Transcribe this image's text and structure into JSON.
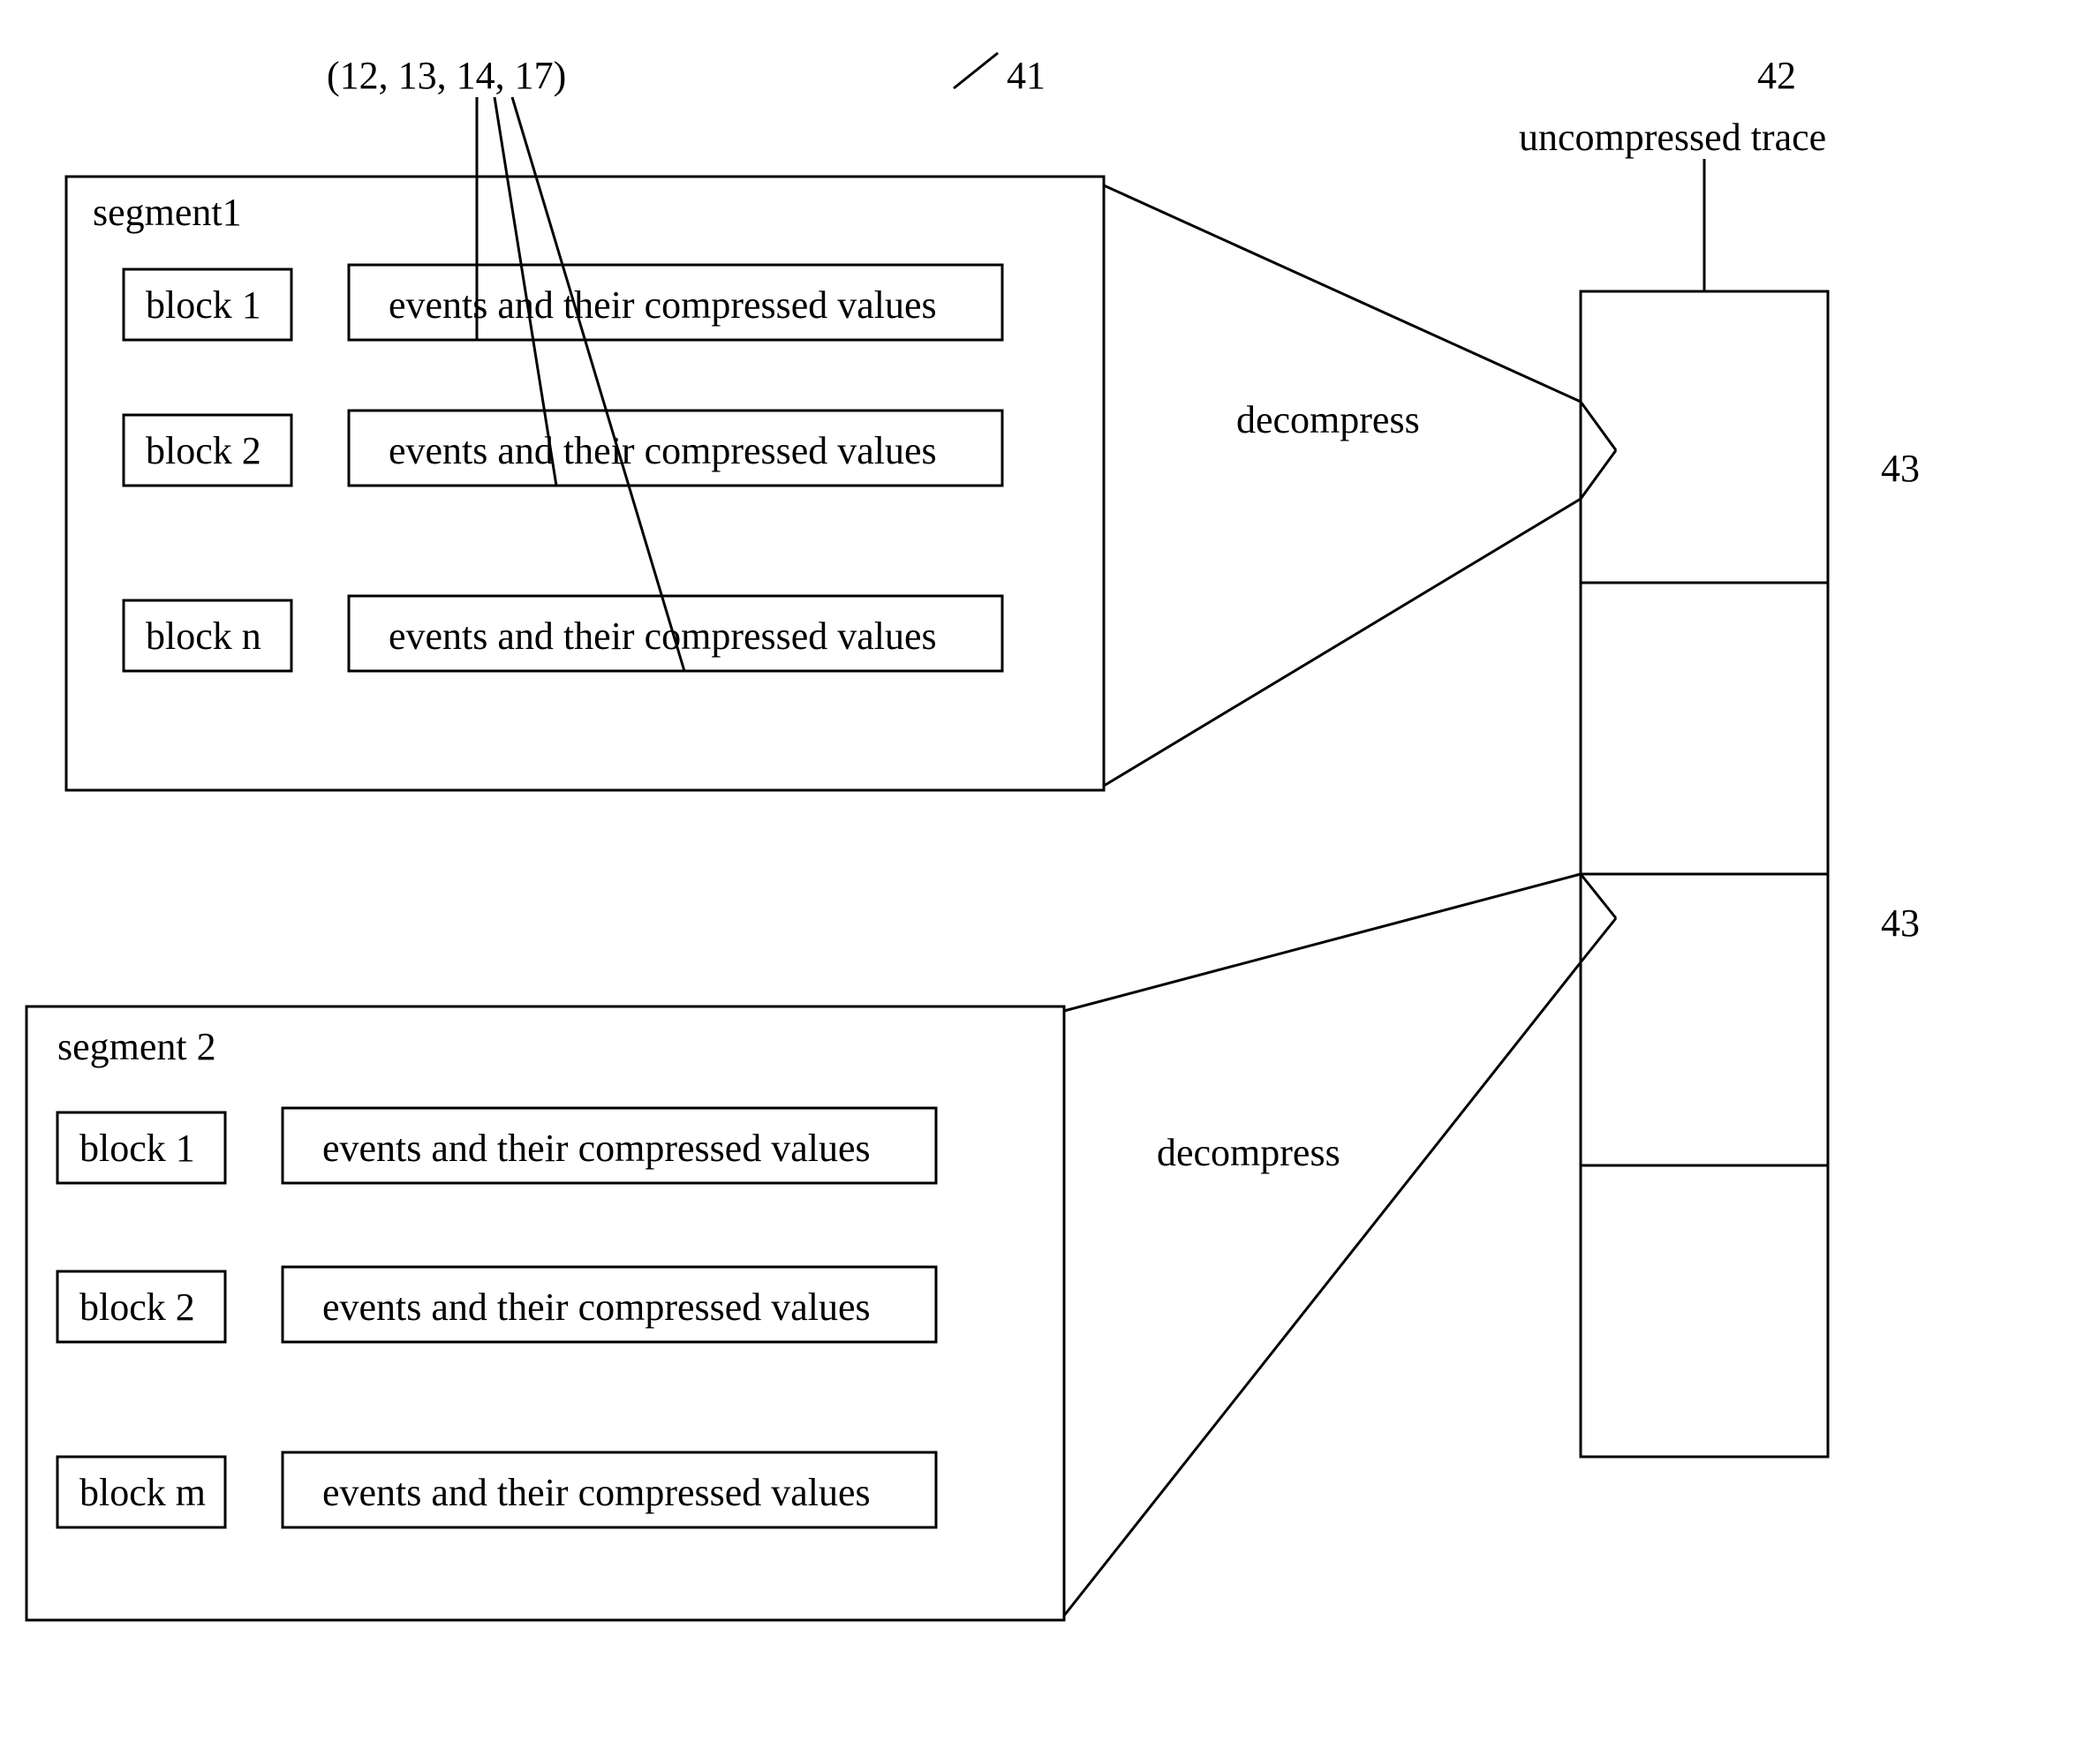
{
  "header": {
    "tuple": "(12, 13, 14, 17)"
  },
  "callouts": {
    "segment1_ref": "41",
    "trace_ref": "42",
    "trace_row_ref_1": "43",
    "trace_row_ref_2": "43"
  },
  "labels": {
    "uncompressed_trace": "uncompressed trace",
    "decompress1": "decompress",
    "decompress2": "decompress"
  },
  "segments": {
    "segment1": {
      "title": "segment1",
      "blocks": [
        "block 1",
        "block 2",
        "block n"
      ],
      "events": [
        "events and their compressed values",
        "events and their compressed values",
        "events and their compressed values"
      ]
    },
    "segment2": {
      "title": "segment 2",
      "blocks": [
        "block 1",
        "block 2",
        "block m"
      ],
      "events": [
        "events and their compressed values",
        "events and their compressed values",
        "events and their compressed values"
      ]
    }
  }
}
